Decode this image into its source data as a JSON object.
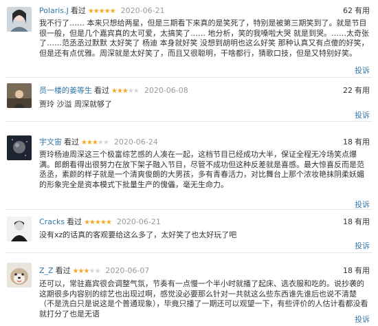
{
  "reviews": [
    {
      "user": "Polaris.J",
      "status": "看过",
      "rating": 5,
      "date": "2020-06-21",
      "useful_count": "62",
      "useful_label": "有用",
      "text": "我不行了…… 本来只想给两星，但是三期看下来真的是笑死了，特别是被第三期笑到了。就是节目很一般，但是几个嘉宾真的太可爱，太搞笑了…… 地分析，笑的我嗓啦大哭 就是到哭。……太奇张了……范丞丞过默默 太好笑了 杨迪 本身就好笑 没想到胡明也这么好笑 那种认真又有点傻的好笑，但是还有点优雅。周深就是太好笑了，而且又很聪明，干啥都行，猜歌口技，但是又特别好笑。",
      "report": "投诉"
    },
    {
      "user": "员一楼的姜等生",
      "status": "看过",
      "rating": 3,
      "date": "2020-06-08",
      "useful_count": "22",
      "useful_label": "有用",
      "text": "贾玲 沙溢 周深就够了",
      "report": "投诉"
    },
    {
      "user": "宇文宙",
      "status": "看过",
      "rating": 3,
      "date": "2020-06-24",
      "useful_count": "18",
      "useful_label": "有用",
      "text": "贾玲杨迪周深这三个极富综艺感的人凑在一起，这档节目已经成功大半，保证全程无冷场笑点爆满。郎朗看得出很努力在放下架子融入节目，尽管不成功但这种反差就是喜感。最大惊喜反而是范丞丞，素颜的样子就是一个清爽俊朗的大男孩，多有青春活力，对比舞台上那个浓妆艳抹阴柔妖媚的形象完全是资本模式下批量生产的傀儡，毫无生命力。",
      "report": "投诉"
    },
    {
      "user": "Cracks",
      "status": "看过",
      "rating": 5,
      "date": "2020-06-21",
      "useful_count": "18",
      "useful_label": "有用",
      "text": "没有xz的话真的客观要给这么多了，太好笑了也太好玩了吧",
      "report": "投诉"
    },
    {
      "user": "Z_Z",
      "status": "看过",
      "rating": 3,
      "date": "2020-06-07",
      "useful_count": "18",
      "useful_label": "有用",
      "text": "还可以，常驻嘉宾很会调整气氛，节奏有一点慢一个半小时就播了起床、选衣服和吃的。说抄袭的这期很多内容别的综艺也出现过啊，感觉没必要那么针对一共就这么些东西谁先谁后也说不清楚（不是洗白只是说这是个普通现象），毕竟只播了一期还可以观望一下，有些评价的人估计看都没看就打分了也是无语",
      "report": "投诉"
    }
  ]
}
